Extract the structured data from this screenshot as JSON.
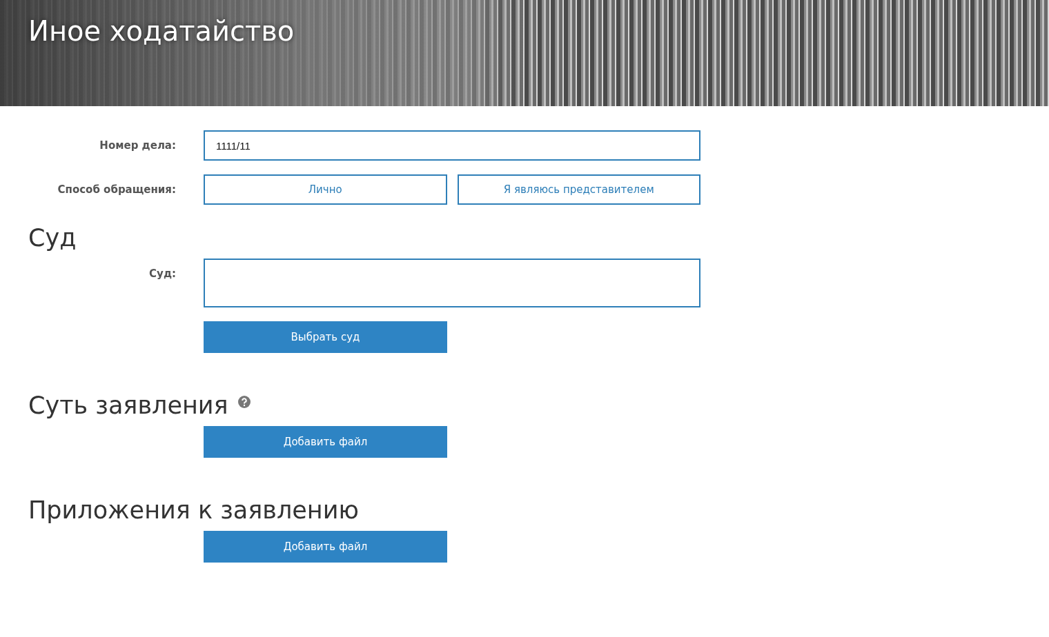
{
  "header": {
    "title": "Иное ходатайство"
  },
  "case_fields": [
    {
      "kind": "text",
      "label": "Номер дела:",
      "value": "1111/11"
    },
    {
      "kind": "choice",
      "label": "Способ обращения:",
      "options": [
        {
          "label": "Лично",
          "selected": false
        },
        {
          "label": "Я являюсь представителем",
          "selected": false
        }
      ]
    }
  ],
  "sections": [
    {
      "heading": "Суд",
      "help": false,
      "fields": [
        {
          "kind": "textarea",
          "label": "Суд:"
        }
      ],
      "button": "Выбрать суд"
    },
    {
      "heading": "Суть заявления",
      "help": true,
      "button": "Добавить файл"
    },
    {
      "heading": "Приложения к заявлению",
      "help": false,
      "button": "Добавить файл"
    }
  ]
}
